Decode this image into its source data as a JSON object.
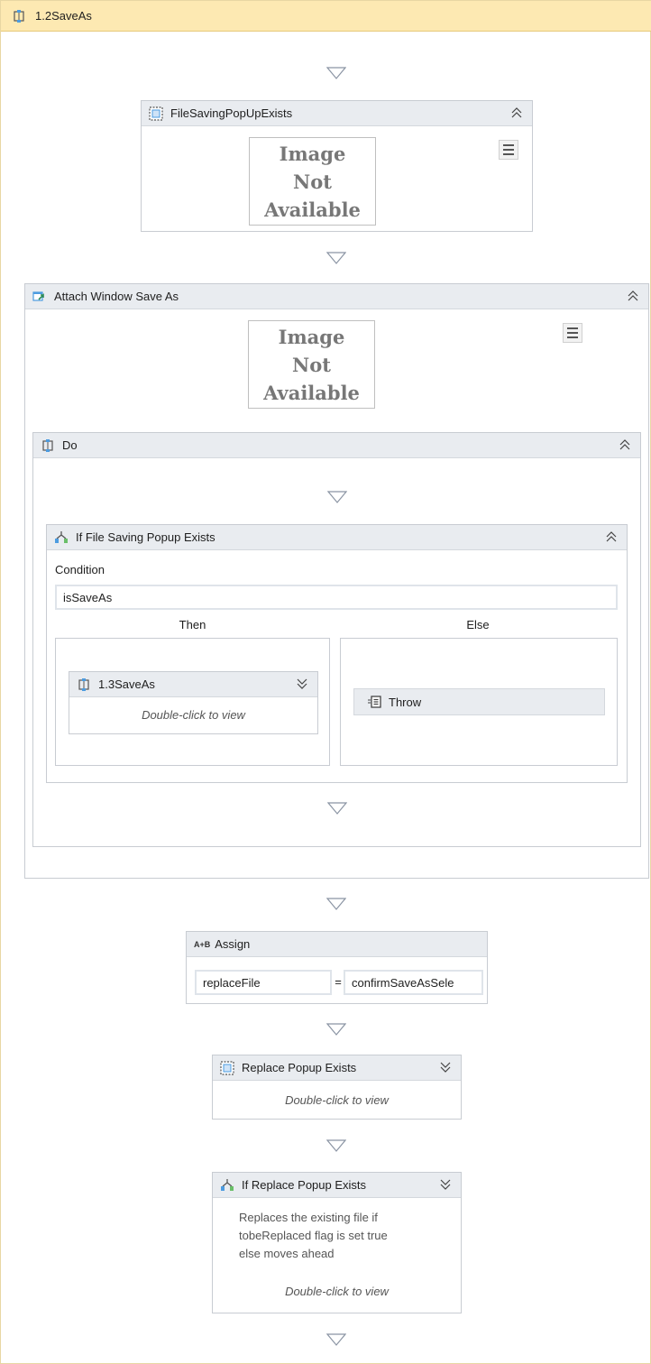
{
  "sequence": {
    "title": "1.2SaveAs"
  },
  "file_saving_popup": {
    "title": "FileSavingPopUpExists"
  },
  "image_placeholder": {
    "line1": "Image",
    "line2": "Not",
    "line3": "Available"
  },
  "attach_window": {
    "title": "Attach Window  Save As"
  },
  "do_block": {
    "title": "Do"
  },
  "if_file_saving": {
    "title": "If File Saving Popup Exists",
    "condition_label": "Condition",
    "condition_value": "isSaveAs",
    "then_label": "Then",
    "else_label": "Else",
    "then_activity": {
      "title": "1.3SaveAs",
      "hint": "Double-click to view"
    },
    "else_activity": {
      "title": "Throw"
    }
  },
  "assign": {
    "title": "Assign",
    "icon_text": "A+B",
    "left": "replaceFile",
    "equals": "=",
    "right": "confirmSaveAsSele"
  },
  "replace_popup": {
    "title": "Replace Popup Exists",
    "hint": "Double-click to view"
  },
  "if_replace_popup": {
    "title": "If Replace Popup Exists",
    "annotation_line1": "Replaces the existing file if",
    "annotation_line2": "tobeReplaced flag is set true",
    "annotation_line3": "else moves ahead",
    "hint": "Double-click to view"
  },
  "colors": {
    "header_bg": "#fde9b2",
    "activity_head_bg": "#e9ecf0",
    "border": "#c8ccd2"
  }
}
